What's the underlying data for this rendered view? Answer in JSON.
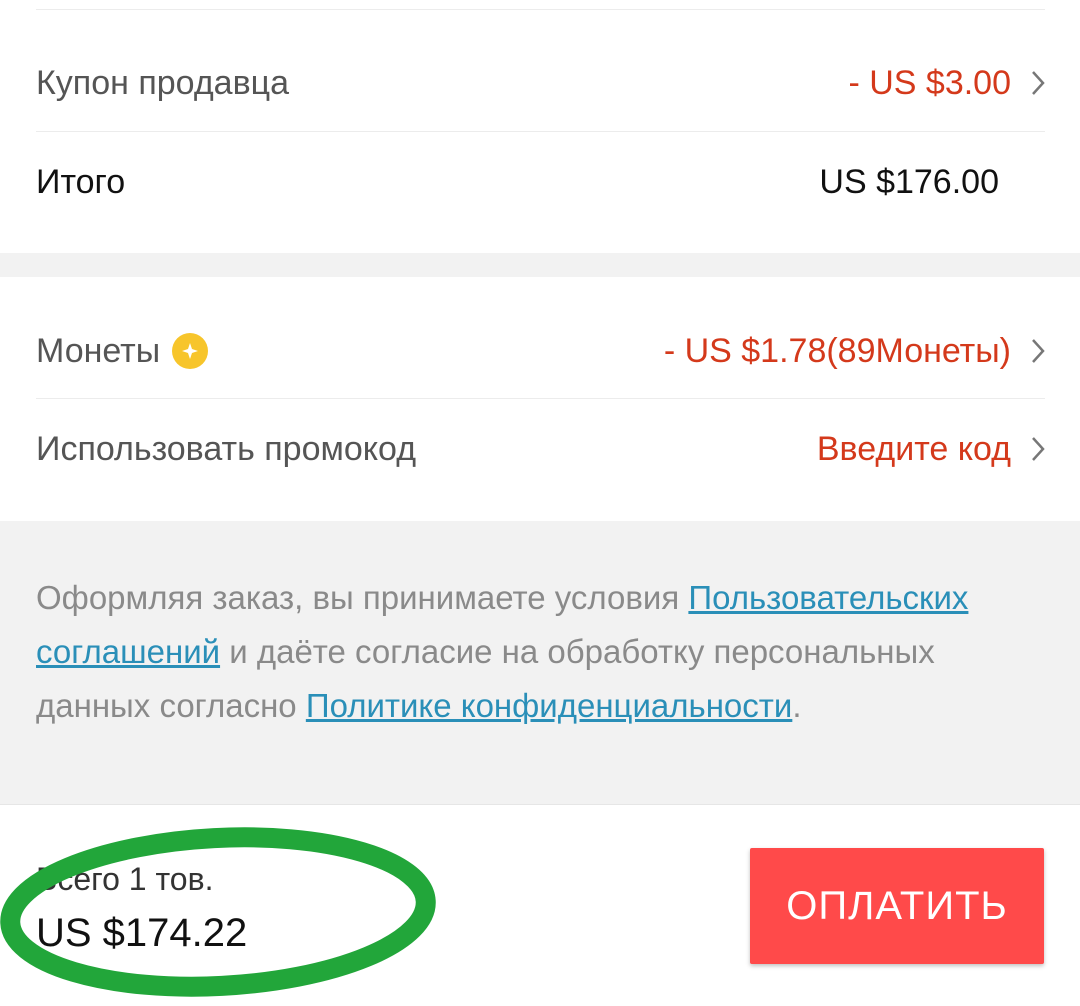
{
  "summary": {
    "seller_coupon": {
      "label": "Купон продавца",
      "value": "- US $3.00"
    },
    "subtotal": {
      "label": "Итого",
      "value": "US $176.00"
    }
  },
  "discounts": {
    "coins": {
      "label": "Монеты",
      "value": "- US $1.78(89Монеты)",
      "icon": "coin-icon"
    },
    "promo": {
      "label": "Использовать промокод",
      "value": "Введите код"
    }
  },
  "notice": {
    "part1": "Оформляя заказ, вы принимаете условия ",
    "link1": "Пользовательских соглашений",
    "part2": " и даёте согласие на обработку персональных данных согласно ",
    "link2": "Политике конфиденциальности",
    "part3": "."
  },
  "footer": {
    "count": "Всего 1 тов.",
    "total": "US $174.22",
    "pay_label": "ОПЛАТИТЬ"
  },
  "colors": {
    "accent_red": "#d4391b",
    "pay_button": "#ff4a4a",
    "link": "#2a8fb8",
    "annotation_green": "#22a63a"
  }
}
